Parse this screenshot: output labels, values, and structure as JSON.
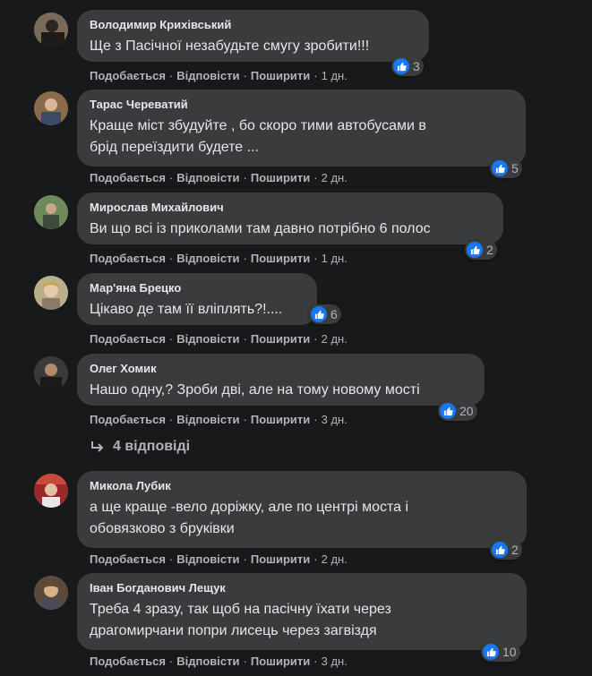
{
  "ui": {
    "like": "Подобається",
    "reply": "Відповісти",
    "share": "Поширити",
    "dot": "·"
  },
  "comments": [
    {
      "author": "Володимир Крихівський",
      "text": [
        "Ще з Пасічної незабудьте смугу зробити!!!"
      ],
      "likes": "3",
      "time": "1 дн."
    },
    {
      "author": "Тарас Череватий",
      "text": [
        "Краще міст збудуйте , бо скоро тими автобусами в",
        "брід переїздити будете ..."
      ],
      "likes": "5",
      "time": "2 дн."
    },
    {
      "author": "Мирослав Михайлович",
      "text": [
        "Ви що всі із приколами там давно потрібно 6 полос"
      ],
      "likes": "2",
      "time": "1 дн."
    },
    {
      "author": "Мар'яна Брецко",
      "text": [
        "Цікаво де там її вліплять?!...."
      ],
      "likes": "6",
      "time": "2 дн."
    },
    {
      "author": "Олег Хомик",
      "text": [
        "Нашо одну,? Зроби дві, але на тому новому мості"
      ],
      "likes": "20",
      "time": "3 дн."
    },
    {
      "author": "Микола Лубик",
      "text": [
        "а ще краще -вело доріжку, але по центрі моста і",
        "обовязково з бруківки"
      ],
      "likes": "2",
      "time": "2 дн."
    },
    {
      "author": "Іван Богданович Лещук",
      "text": [
        "Треба 4 зразу, так щоб на пасічну їхати через",
        "драгомирчани попри лисець через загвіздя"
      ],
      "likes": "10",
      "time": "3 дн."
    }
  ],
  "replies_link": "4 відповіді",
  "colors": {
    "background": "#18191a",
    "bubble": "#3a3b3c",
    "text": "#e4e6eb",
    "muted": "#b0b3b8",
    "like": "#1877f2"
  }
}
